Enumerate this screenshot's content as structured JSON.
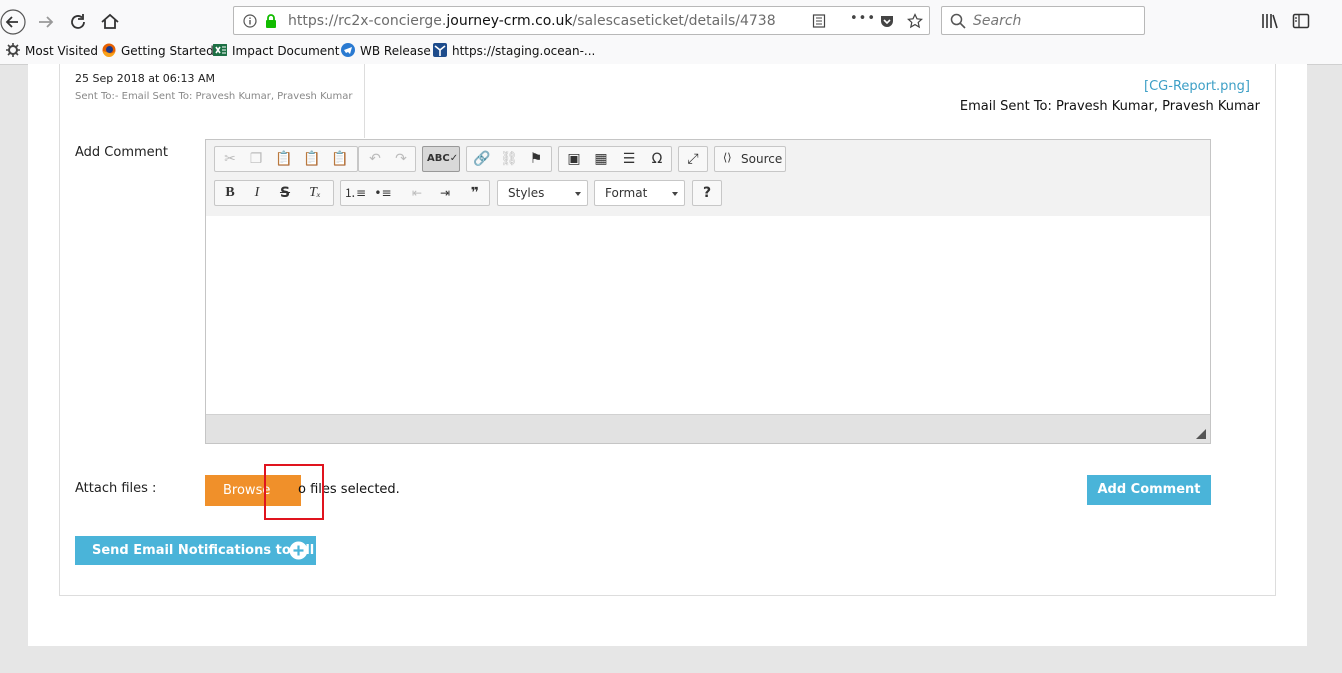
{
  "browser": {
    "url_prefix": "https://rc2x-concierge.",
    "url_domain": "journey-crm.co.uk",
    "url_path": "/salescaseticket/details/4738",
    "search_placeholder": "Search",
    "more_icon": "•••",
    "bookmarks": [
      {
        "label": "Most Visited",
        "icon": "gear-icon"
      },
      {
        "label": "Getting Started",
        "icon": "firefox-icon"
      },
      {
        "label": "Impact Document",
        "icon": "excel-icon"
      },
      {
        "label": "WB Release",
        "icon": "telegram-icon"
      },
      {
        "label": "https://staging.ocean-...",
        "icon": "site-icon"
      }
    ]
  },
  "message": {
    "date": "25 Sep 2018 at 06:13 AM",
    "sent_to_small": "Sent To:- Email Sent To: Pravesh Kumar, Pravesh Kumar",
    "attachment_link": "[CG-Report.png]",
    "email_sent_to": "Email Sent To: Pravesh Kumar, Pravesh Kumar"
  },
  "form": {
    "add_comment_label": "Add Comment",
    "attach_label": "Attach files :",
    "browse_label": "Browse",
    "no_files_text": "o files selected.",
    "submit_label": "Add Comment",
    "notify_label": "Send Email Notifications to All"
  },
  "editor": {
    "source_label": "Source",
    "styles_label": "Styles",
    "format_label": "Format",
    "help_label": "?"
  },
  "colors": {
    "accent_blue": "#4ab4d9",
    "browse_orange": "#f0902a",
    "highlight_red": "#e0141e",
    "link_blue": "#3d9fc6"
  }
}
